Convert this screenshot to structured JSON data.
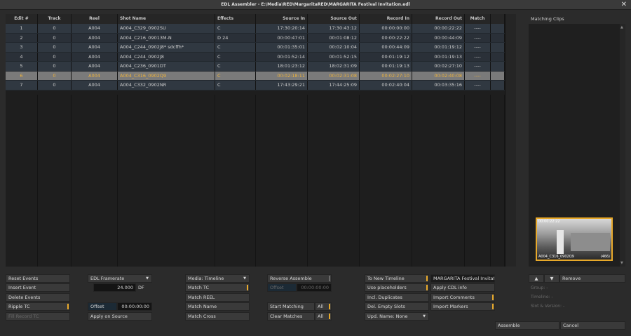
{
  "window": {
    "title": "EDL Assembler - E:\\Media\\RED\\MargaritaRED\\MARGARITA Festival Invitation.edl",
    "close_icon": "✕"
  },
  "table": {
    "headers": [
      "Edit #",
      "Track",
      "Reel",
      "Shot Name",
      "Effects",
      "Source In",
      "Source Out",
      "Record In",
      "Record Out",
      "Match"
    ],
    "rows": [
      [
        "1",
        "0",
        "A004",
        "A004_C329_0902SU",
        "C",
        "17:30:20:14",
        "17:30:43:12",
        "00:00:00:00",
        "00:00:22:22",
        "----"
      ],
      [
        "2",
        "0",
        "A004",
        "A004_C216_09013M-N",
        "D 24",
        "00:00:47:01",
        "00:01:08:12",
        "00:00:22:22",
        "00:00:44:09",
        "----"
      ],
      [
        "3",
        "0",
        "A004",
        "A004_C244_0902J8* sdcffh*",
        "C",
        "00:01:35:01",
        "00:02:10:04",
        "00:00:44:09",
        "00:01:19:12",
        "----"
      ],
      [
        "4",
        "0",
        "A004",
        "A004_C244_0902J8",
        "C",
        "00:01:52:14",
        "00:01:52:15",
        "00:01:19:12",
        "00:01:19:13",
        "----"
      ],
      [
        "5",
        "0",
        "A004",
        "A004_C236_0901DT",
        "C",
        "18:01:23:12",
        "18:02:31:09",
        "00:01:19:13",
        "00:02:27:10",
        "----"
      ],
      [
        "6",
        "0",
        "A004",
        "A004_C316_0902Q9",
        "C",
        "00:02:18:11",
        "00:02:31:08",
        "00:02:27:10",
        "00:02:40:08",
        "----"
      ],
      [
        "7",
        "0",
        "A004",
        "A004_C332_0902NR",
        "C",
        "17:43:29:21",
        "17:44:25:09",
        "00:02:40:04",
        "00:03:35:16",
        "----"
      ]
    ],
    "selected_row": 5
  },
  "matching": {
    "title": "Matching Clips",
    "thumb": {
      "timecode": "00:00:22:22",
      "name": "A004_C316_0902Q9",
      "count": "(466)"
    },
    "up_label": "▲",
    "down_label": "▼",
    "remove_label": "Remove",
    "group_label": "Group: -",
    "timeline_label": "Timeline: -",
    "slot_label": "Slot & Version: -",
    "scroll_up": "▲",
    "scroll_down": "▼"
  },
  "col1": {
    "reset": "Reset Events",
    "insert": "Insert Event",
    "delete": "Delete Events",
    "ripple": "Ripple TC",
    "fill": "Fill Record TC"
  },
  "col2": {
    "framerate_label": "EDL Framerate",
    "framerate_value": "24.000",
    "df": "DF",
    "offset_label": "Offset",
    "offset_value": "00:00:00:00",
    "apply": "Apply on Source",
    "dropdown_arrow": "▼"
  },
  "col3": {
    "media": "Media: Timeline",
    "match_tc": "Match TC",
    "match_reel": "Match REEL",
    "match_name": "Match Name",
    "match_cross": "Match Cross",
    "dropdown_arrow": "▼"
  },
  "col4": {
    "reverse": "Reverse Assemble",
    "offset_label": "Offset",
    "offset_value": "00:00:00:00",
    "start_matching": "Start Matching",
    "clear_matches": "Clear Matches",
    "all1": "All",
    "all2": "All"
  },
  "col5": {
    "to_timeline": "To New Timeline",
    "use_placeholders": "Use placeholders",
    "incl_dup": "Incl. Duplicates",
    "del_empty": "Del. Empty Slots",
    "upd_name": "Upd. Name: None",
    "dropdown_arrow": "▼"
  },
  "col6": {
    "timeline_name": "MARGARITA Festival Invitati",
    "apply_cdl": "Apply CDL info",
    "import_comments": "Import Comments",
    "import_markers": "Import Markers"
  },
  "footer": {
    "assemble": "Assemble",
    "cancel": "Cancel"
  }
}
